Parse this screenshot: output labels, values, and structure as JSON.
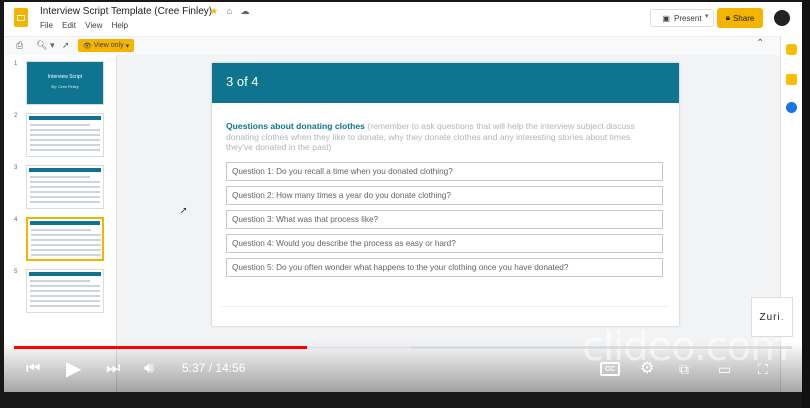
{
  "doc": {
    "title": "Interview Script Template (Cree Finley)",
    "menu": [
      "File",
      "Edit",
      "View",
      "Help"
    ],
    "present_label": "Present",
    "share_label": "Share",
    "view_only_label": "View only"
  },
  "filmstrip": {
    "numbers": [
      "1",
      "2",
      "3",
      "4",
      "5"
    ],
    "slide1_title": "Interview Script",
    "slide1_subtitle": "By: Cree Finley",
    "selected_index": 4
  },
  "slide": {
    "header": "3 of 4",
    "heading": "Questions about donating clothes",
    "note": "(remember to ask questions that will help the interview subject discuss donating clothes when they like to donate, why they donate clothes and any interesting stories about times they've donated in the past)",
    "questions": [
      "Question 1: Do you recall a time when you donated clothing?",
      "Question 2: How many times a year do you donate clothing?",
      "Question 3: What was that process like?",
      "Question 4: Would you describe the process as easy or hard?",
      "Question 5: Do you often wonder what happens to the your clothing once you have donated?"
    ]
  },
  "player": {
    "time": "5:37 / 14:56",
    "progress_fraction": 0.376,
    "buffered_fraction": 0.51,
    "cc_label": "CC",
    "watermark": "clideo.com",
    "brand": "Zuri",
    "brand_dot": "."
  },
  "colors": {
    "accent": "#f4b400",
    "slide_header": "#0e7490",
    "progress": "#ff0000"
  }
}
